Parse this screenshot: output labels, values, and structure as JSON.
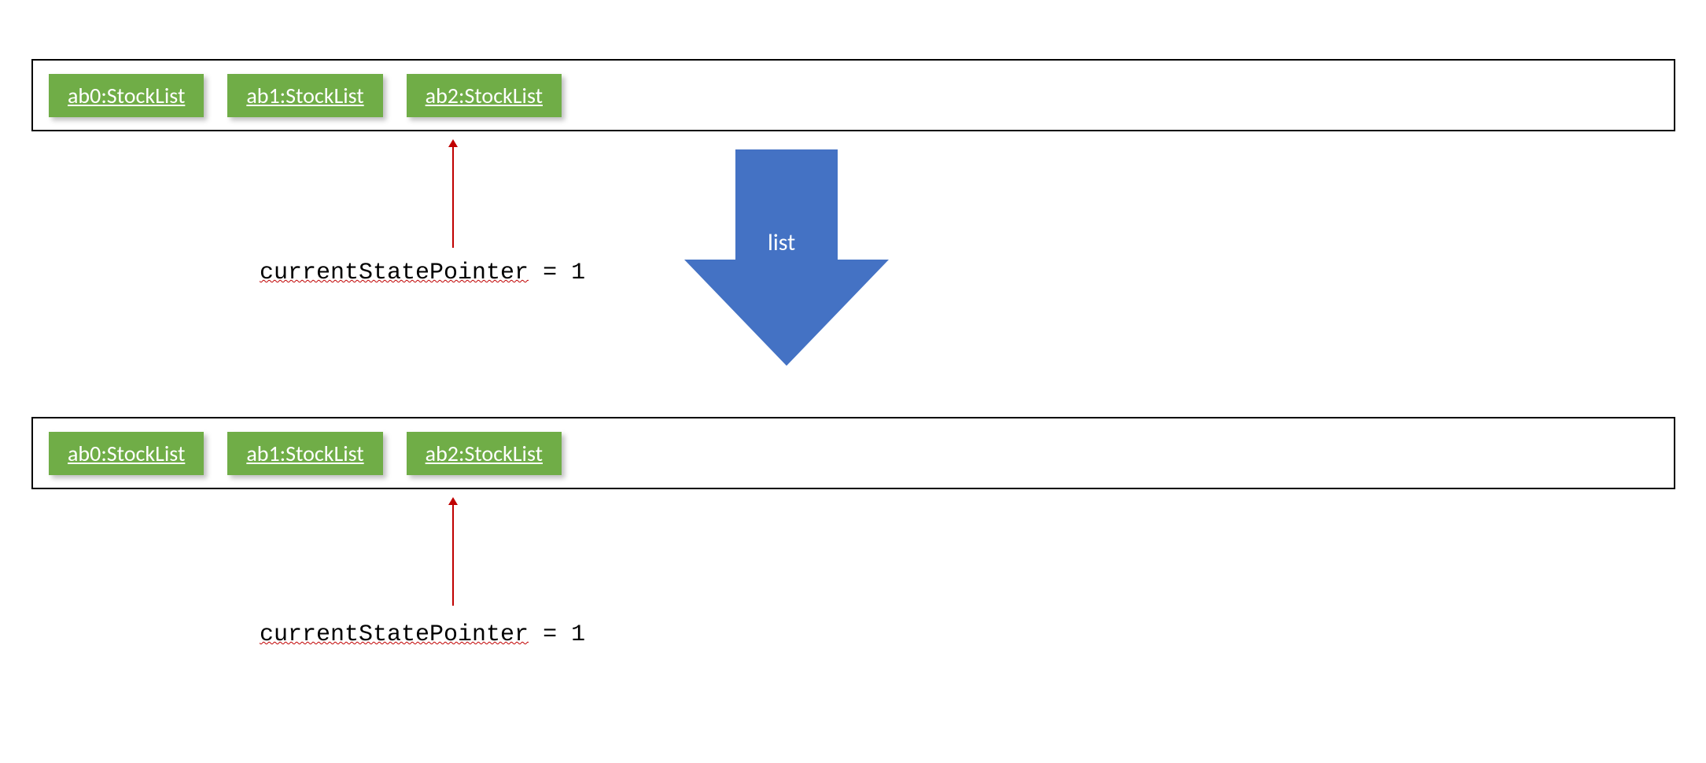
{
  "top_list": {
    "items": [
      "ab0:StockList",
      "ab1:StockList",
      "ab2:StockList"
    ]
  },
  "bottom_list": {
    "items": [
      "ab0:StockList",
      "ab1:StockList",
      "ab2:StockList"
    ]
  },
  "pointer_top": {
    "label_prefix": "currentStatePointer",
    "label_suffix": " = 1"
  },
  "pointer_bottom": {
    "label_prefix": "currentStatePointer",
    "label_suffix": " = 1"
  },
  "arrow": {
    "label": "list"
  }
}
